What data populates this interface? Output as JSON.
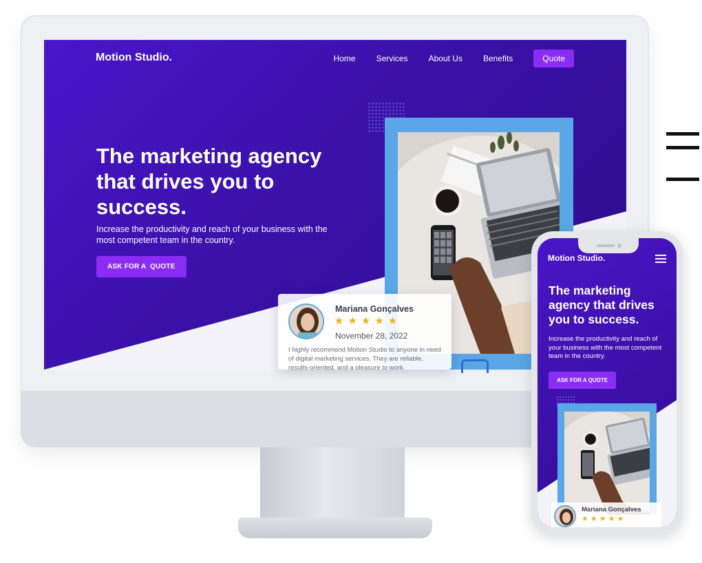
{
  "desktop": {
    "logo": "Motion Studio",
    "logo_dot": ".",
    "nav": [
      {
        "label": "Home"
      },
      {
        "label": "Services"
      },
      {
        "label": "About Us"
      },
      {
        "label": "Benefits"
      }
    ],
    "nav_quote": "Quote",
    "hero_title": "The marketing agency that drives you to success.",
    "hero_subtitle": "Increase the productivity and reach of your business with the most competent team in the country.",
    "cta": "ASK FOR A  QUOTE",
    "review": {
      "name": "Mariana Gonçalves",
      "stars": "★★★★★",
      "date": "November 28, 2022",
      "text": "I highly recommend Motion Studio to anyone in need of digital marketing services. They are reliable, results-oriented, and a pleasure to work"
    }
  },
  "mobile": {
    "logo": "Motion Studio",
    "logo_dot": ".",
    "hero_title": "The marketing agency that drives you to success.",
    "hero_subtitle": "Increase the productivity and reach of your business with the most competent team in the country.",
    "cta": "ASK FOR A QUOTE",
    "review": {
      "name": "Mariana Gonçalves",
      "stars": "★★★★★"
    }
  },
  "colors": {
    "brand_purple": "#4a15c9",
    "accent_violet": "#8b2cf5",
    "frame_blue": "#5aa6e6",
    "star_gold": "#f1b21b"
  }
}
